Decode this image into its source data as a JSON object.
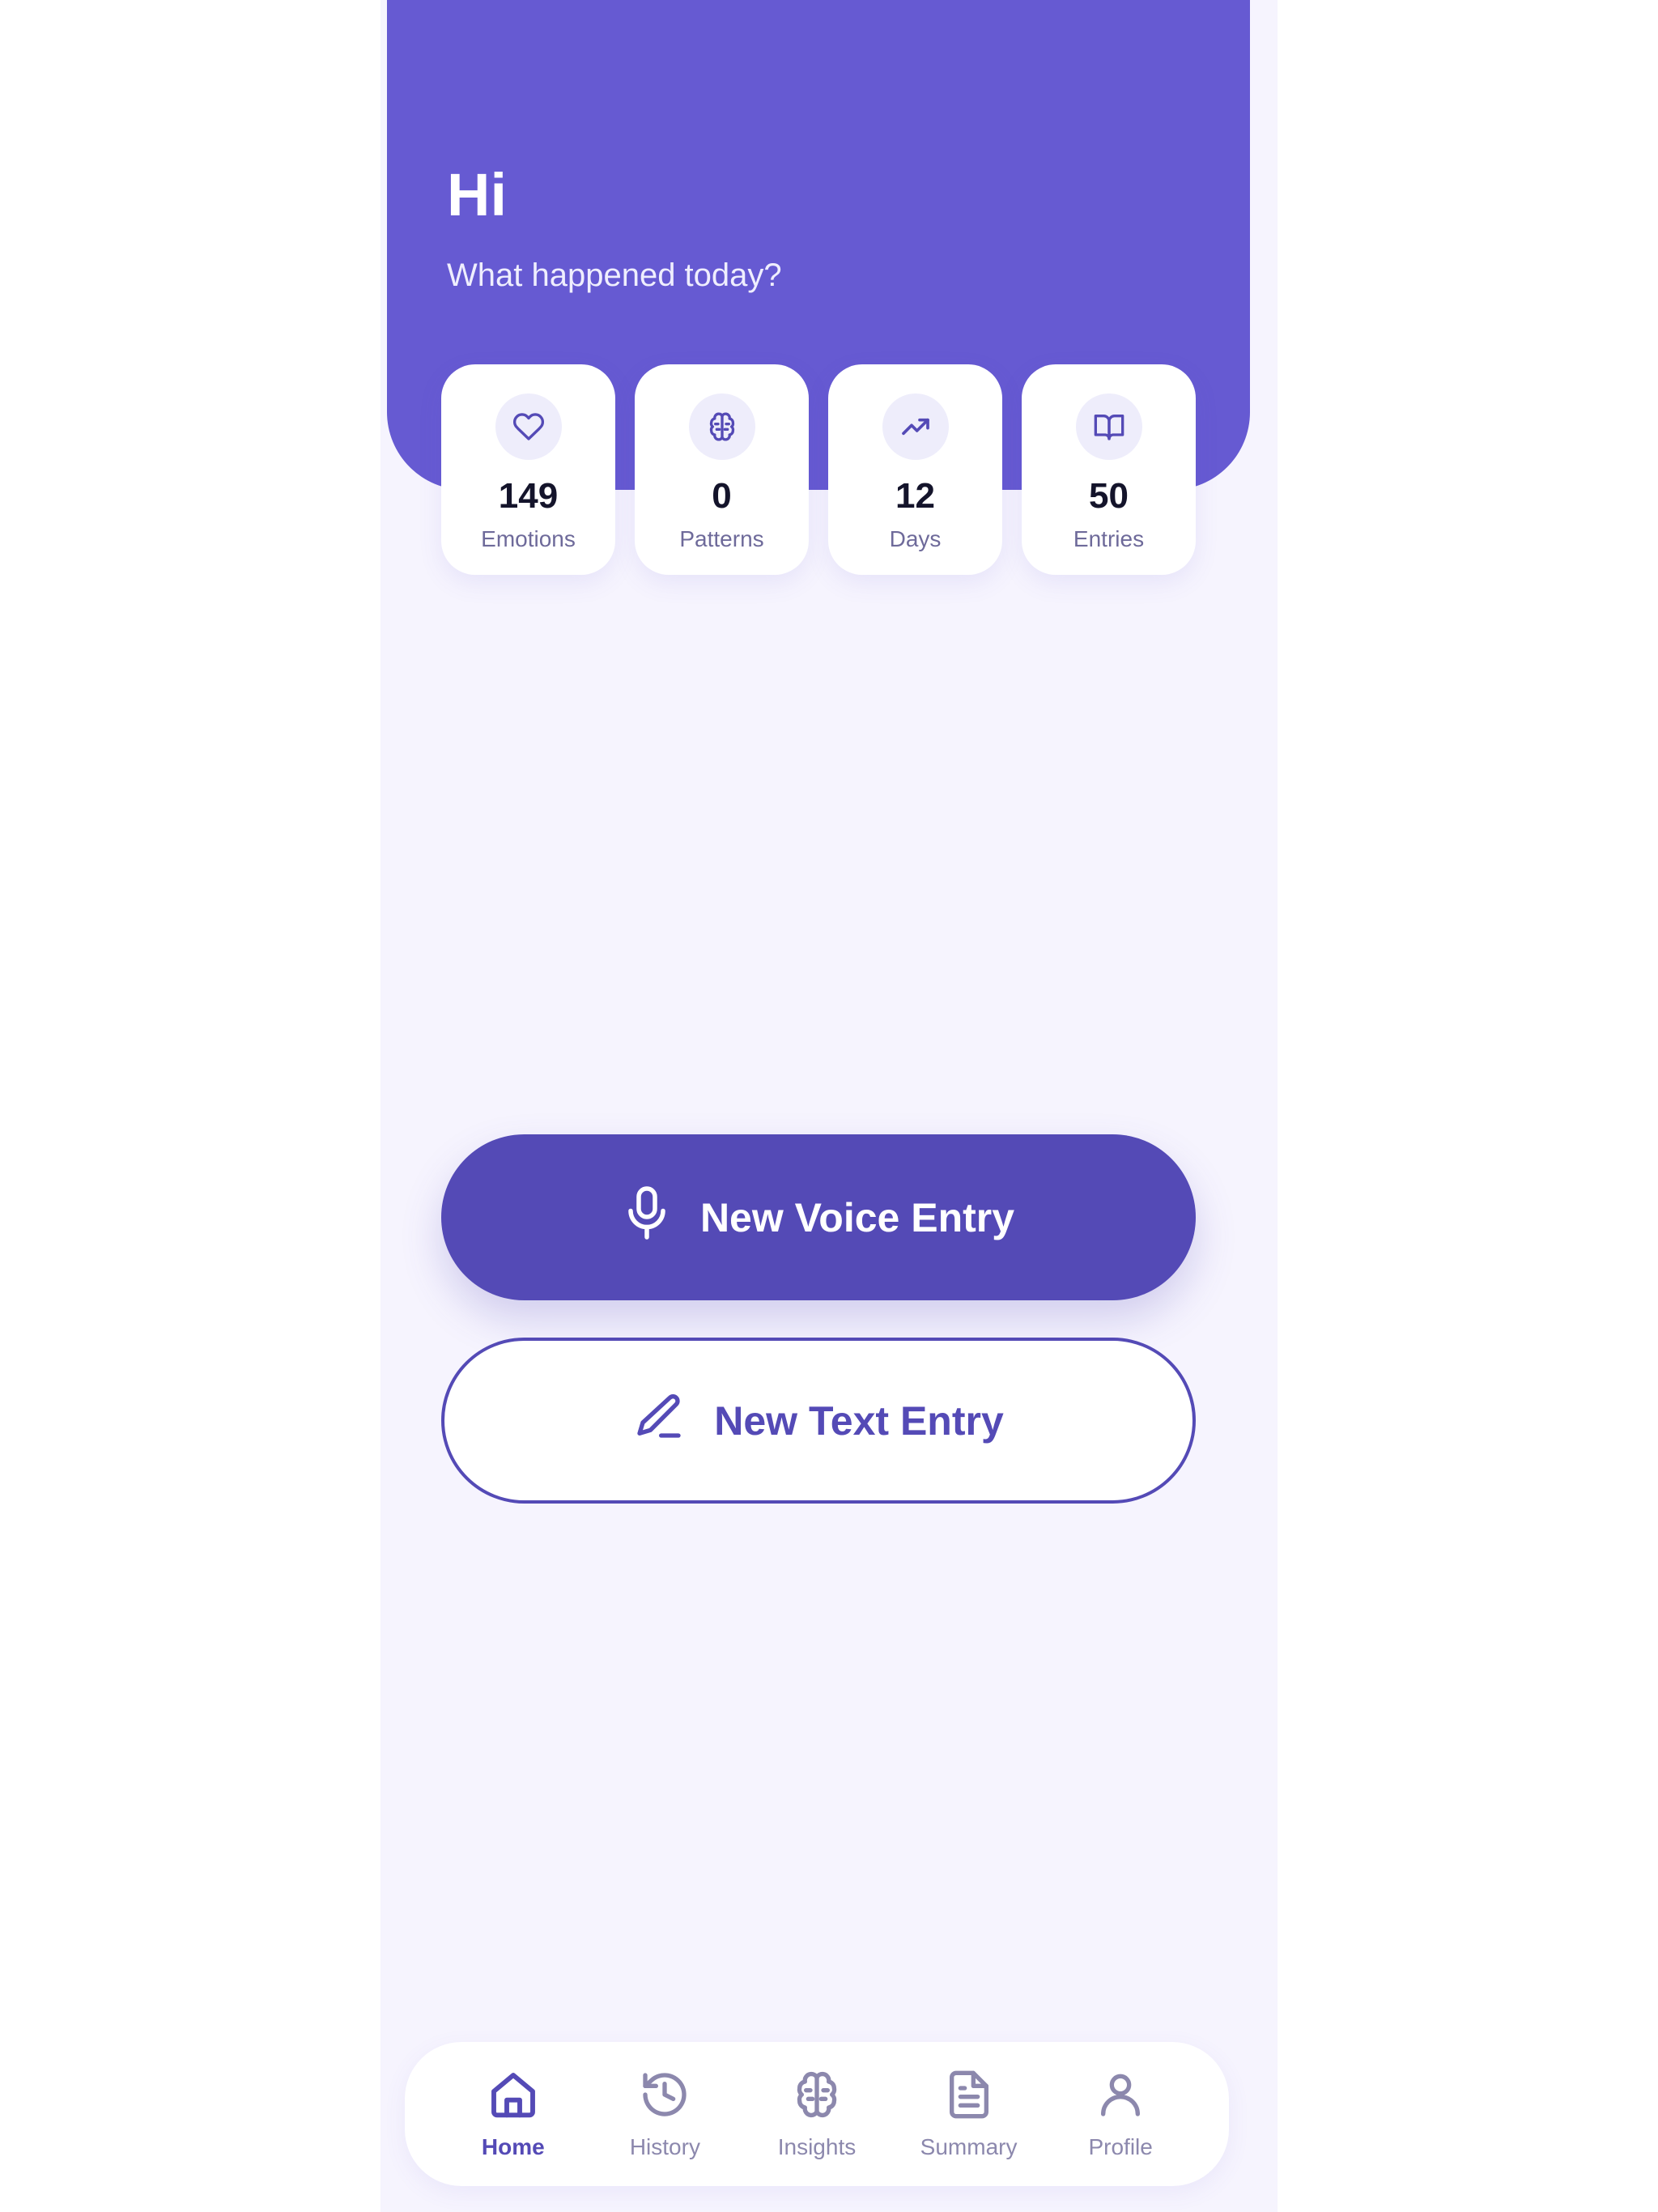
{
  "header": {
    "greeting": "Hi",
    "subtitle": "What happened today?"
  },
  "stats": [
    {
      "icon": "heart-icon",
      "value": "149",
      "label": "Emotions"
    },
    {
      "icon": "brain-icon",
      "value": "0",
      "label": "Patterns"
    },
    {
      "icon": "trending-up-icon",
      "value": "12",
      "label": "Days"
    },
    {
      "icon": "book-open-icon",
      "value": "50",
      "label": "Entries"
    }
  ],
  "actions": {
    "voice_label": "New Voice Entry",
    "text_label": "New Text Entry"
  },
  "nav": {
    "items": [
      {
        "label": "Home",
        "icon": "home-icon",
        "active": true
      },
      {
        "label": "History",
        "icon": "history-icon",
        "active": false
      },
      {
        "label": "Insights",
        "icon": "brain-icon",
        "active": false
      },
      {
        "label": "Summary",
        "icon": "document-icon",
        "active": false
      },
      {
        "label": "Profile",
        "icon": "user-icon",
        "active": false
      }
    ]
  },
  "colors": {
    "primary": "#665ad2",
    "primary_dark": "#544ab6",
    "background": "#f6f4fe",
    "surface": "#ffffff"
  }
}
